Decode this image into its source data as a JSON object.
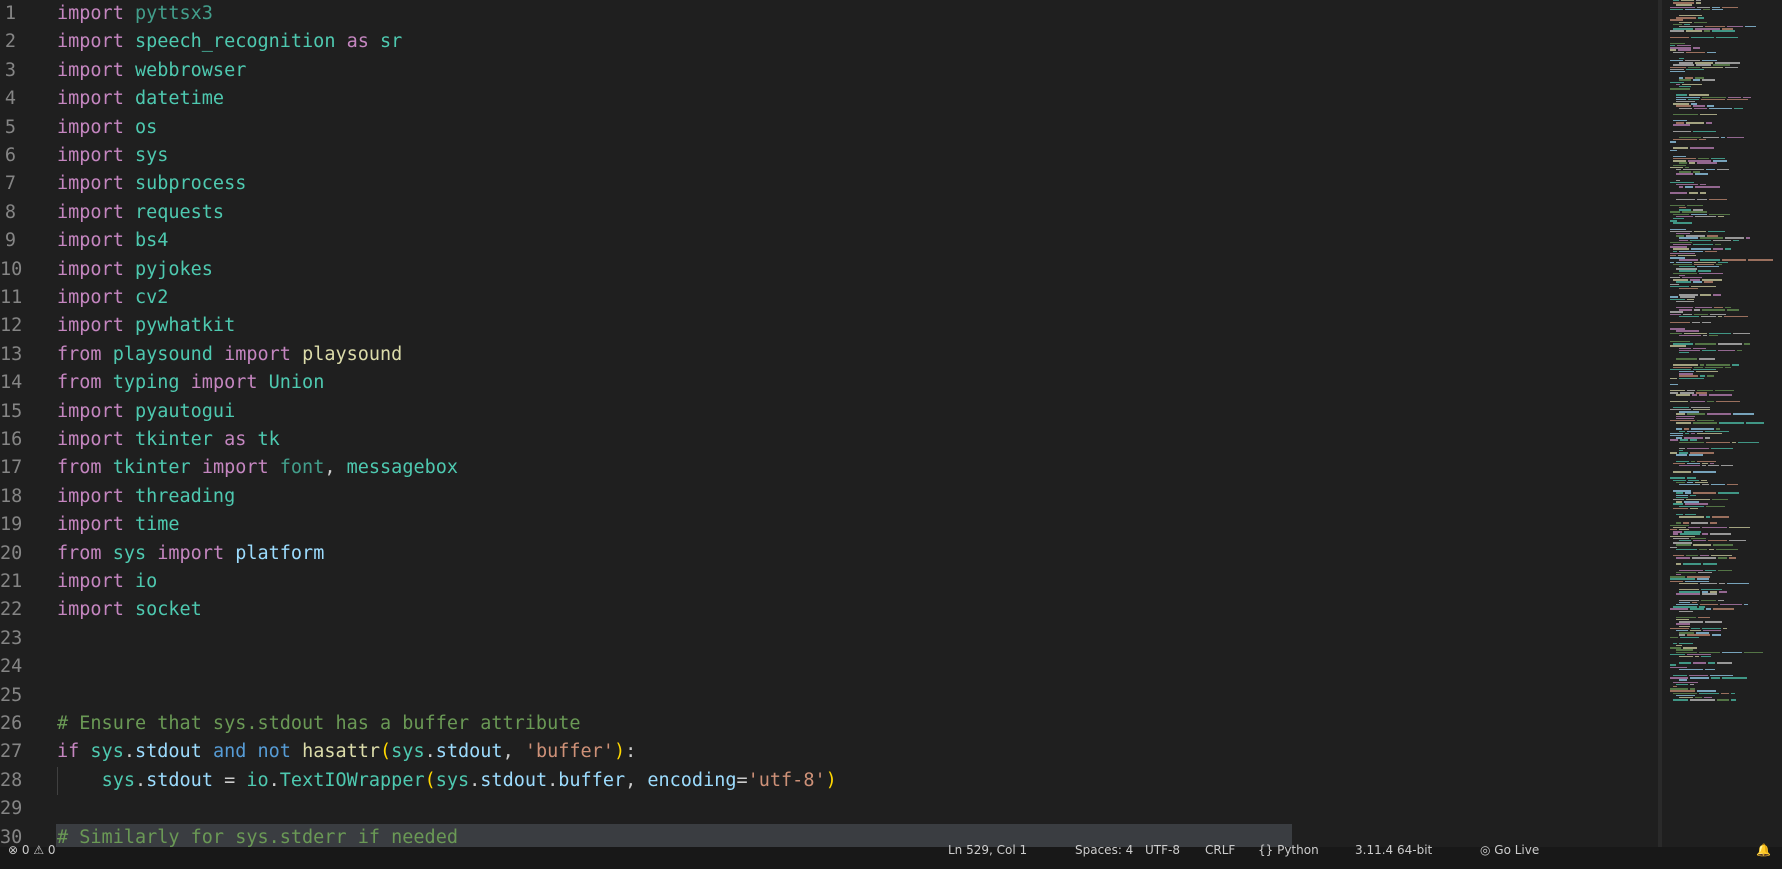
{
  "editor": {
    "lines": [
      {
        "n": "1",
        "tokens": [
          [
            "kw",
            "import "
          ],
          [
            "grey",
            "pyttsx3"
          ]
        ]
      },
      {
        "n": "2",
        "tokens": [
          [
            "kw",
            "import "
          ],
          [
            "mod",
            "speech_recognition "
          ],
          [
            "kw",
            "as "
          ],
          [
            "mod",
            "sr"
          ]
        ]
      },
      {
        "n": "3",
        "tokens": [
          [
            "kw",
            "import "
          ],
          [
            "mod",
            "webbrowser"
          ]
        ]
      },
      {
        "n": "4",
        "tokens": [
          [
            "kw",
            "import "
          ],
          [
            "mod",
            "datetime"
          ]
        ]
      },
      {
        "n": "5",
        "tokens": [
          [
            "kw",
            "import "
          ],
          [
            "mod",
            "os"
          ]
        ]
      },
      {
        "n": "6",
        "tokens": [
          [
            "kw",
            "import "
          ],
          [
            "mod",
            "sys"
          ]
        ]
      },
      {
        "n": "7",
        "tokens": [
          [
            "kw",
            "import "
          ],
          [
            "mod",
            "subprocess"
          ]
        ]
      },
      {
        "n": "8",
        "tokens": [
          [
            "kw",
            "import "
          ],
          [
            "mod",
            "requests"
          ]
        ]
      },
      {
        "n": "9",
        "tokens": [
          [
            "kw",
            "import "
          ],
          [
            "mod",
            "bs4"
          ]
        ]
      },
      {
        "n": "10",
        "tokens": [
          [
            "kw",
            "import "
          ],
          [
            "mod",
            "pyjokes"
          ]
        ]
      },
      {
        "n": "11",
        "tokens": [
          [
            "kw",
            "import "
          ],
          [
            "mod",
            "cv2"
          ]
        ]
      },
      {
        "n": "12",
        "tokens": [
          [
            "kw",
            "import "
          ],
          [
            "mod",
            "pywhatkit"
          ]
        ]
      },
      {
        "n": "13",
        "tokens": [
          [
            "kw",
            "from "
          ],
          [
            "mod",
            "playsound "
          ],
          [
            "kw",
            "import "
          ],
          [
            "fn",
            "playsound"
          ]
        ]
      },
      {
        "n": "14",
        "tokens": [
          [
            "kw",
            "from "
          ],
          [
            "mod",
            "typing "
          ],
          [
            "kw",
            "import "
          ],
          [
            "mod",
            "Union"
          ]
        ]
      },
      {
        "n": "15",
        "tokens": [
          [
            "kw",
            "import "
          ],
          [
            "mod",
            "pyautogui"
          ]
        ]
      },
      {
        "n": "16",
        "tokens": [
          [
            "kw",
            "import "
          ],
          [
            "mod",
            "tkinter "
          ],
          [
            "kw",
            "as "
          ],
          [
            "mod",
            "tk"
          ]
        ]
      },
      {
        "n": "17",
        "tokens": [
          [
            "kw",
            "from "
          ],
          [
            "mod",
            "tkinter "
          ],
          [
            "kw",
            "import "
          ],
          [
            "grey",
            "font"
          ],
          [
            "punc",
            ", "
          ],
          [
            "mod",
            "messagebox"
          ]
        ]
      },
      {
        "n": "18",
        "tokens": [
          [
            "kw",
            "import "
          ],
          [
            "mod",
            "threading"
          ]
        ]
      },
      {
        "n": "19",
        "tokens": [
          [
            "kw",
            "import "
          ],
          [
            "mod",
            "time"
          ]
        ]
      },
      {
        "n": "20",
        "tokens": [
          [
            "kw",
            "from "
          ],
          [
            "mod",
            "sys "
          ],
          [
            "kw",
            "import "
          ],
          [
            "var",
            "platform"
          ]
        ]
      },
      {
        "n": "21",
        "tokens": [
          [
            "kw",
            "import "
          ],
          [
            "mod",
            "io"
          ]
        ]
      },
      {
        "n": "22",
        "tokens": [
          [
            "kw",
            "import "
          ],
          [
            "mod",
            "socket"
          ]
        ]
      },
      {
        "n": "23",
        "tokens": []
      },
      {
        "n": "24",
        "tokens": []
      },
      {
        "n": "25",
        "tokens": []
      },
      {
        "n": "26",
        "tokens": [
          [
            "cm",
            "# Ensure that sys.stdout has a buffer attribute"
          ]
        ]
      },
      {
        "n": "27",
        "tokens": [
          [
            "kw",
            "if "
          ],
          [
            "mod",
            "sys"
          ],
          [
            "punc",
            "."
          ],
          [
            "var",
            "stdout "
          ],
          [
            "blue",
            "and not "
          ],
          [
            "fn",
            "hasattr"
          ],
          [
            "br",
            "("
          ],
          [
            "mod",
            "sys"
          ],
          [
            "punc",
            "."
          ],
          [
            "var",
            "stdout"
          ],
          [
            "punc",
            ", "
          ],
          [
            "str",
            "'buffer'"
          ],
          [
            "br",
            ")"
          ],
          [
            "punc",
            ":"
          ]
        ]
      },
      {
        "n": "28",
        "indent": true,
        "tokens": [
          [
            "punc",
            "    "
          ],
          [
            "mod",
            "sys"
          ],
          [
            "punc",
            "."
          ],
          [
            "var",
            "stdout "
          ],
          [
            "punc",
            "= "
          ],
          [
            "mod",
            "io"
          ],
          [
            "punc",
            "."
          ],
          [
            "mod",
            "TextIOWrapper"
          ],
          [
            "br",
            "("
          ],
          [
            "mod",
            "sys"
          ],
          [
            "punc",
            "."
          ],
          [
            "var",
            "stdout"
          ],
          [
            "punc",
            "."
          ],
          [
            "var",
            "buffer"
          ],
          [
            "punc",
            ", "
          ],
          [
            "var",
            "encoding"
          ],
          [
            "punc",
            "="
          ],
          [
            "str",
            "'utf-8'"
          ],
          [
            "br",
            ")"
          ]
        ]
      },
      {
        "n": "29",
        "tokens": []
      },
      {
        "n": "30",
        "highlight": true,
        "tokens": [
          [
            "cm",
            "# Similarly for sys.stderr if needed"
          ]
        ]
      }
    ]
  },
  "statusbar": {
    "left": "⊗ 0  ⚠ 0",
    "position": "Ln 529, Col 1",
    "spaces": "Spaces: 4",
    "encoding": "UTF-8",
    "eol": "CRLF",
    "language": "{} Python",
    "interpreter": "3.11.4 64-bit",
    "golive": "◎ Go Live",
    "notify": "🔔"
  },
  "colors": {
    "background": "#1f1f1f",
    "keyword": "#c586c0",
    "module": "#4ec9b0",
    "function": "#dcdcaa",
    "variable": "#9cdcfe",
    "string": "#ce9178",
    "comment": "#6a9955"
  }
}
